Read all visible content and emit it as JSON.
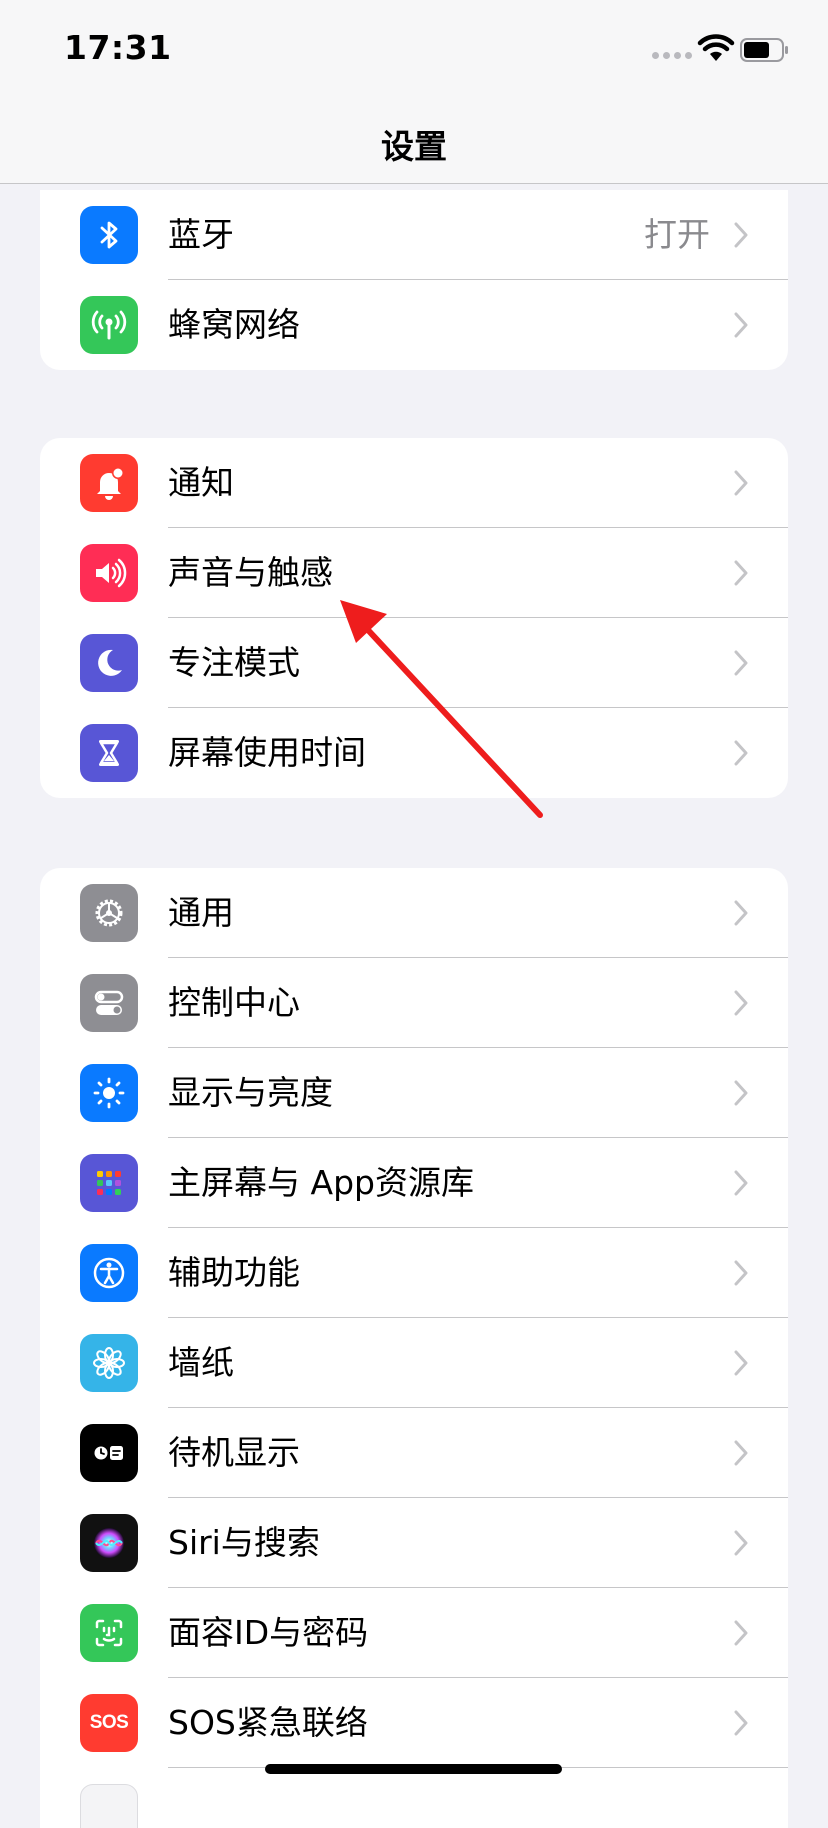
{
  "status_bar": {
    "time": "17:31"
  },
  "nav": {
    "title": "设置"
  },
  "group1": {
    "bluetooth": {
      "label": "蓝牙",
      "value": "打开"
    },
    "cellular": {
      "label": "蜂窝网络"
    }
  },
  "group2": {
    "notifications": {
      "label": "通知"
    },
    "sounds": {
      "label": "声音与触感"
    },
    "focus": {
      "label": "专注模式"
    },
    "screen_time": {
      "label": "屏幕使用时间"
    }
  },
  "group3": {
    "general": {
      "label": "通用"
    },
    "control_center": {
      "label": "控制中心"
    },
    "display": {
      "label": "显示与亮度"
    },
    "home_screen": {
      "label": "主屏幕与 App资源库"
    },
    "accessibility": {
      "label": "辅助功能"
    },
    "wallpaper": {
      "label": "墙纸"
    },
    "standby": {
      "label": "待机显示"
    },
    "siri": {
      "label": "Siri与搜索"
    },
    "face_id": {
      "label": "面容ID与密码"
    },
    "sos": {
      "label": "SOS紧急联络",
      "icon_text": "SOS"
    }
  },
  "colors": {
    "blue": "#0a7aff",
    "green": "#34c759",
    "red": "#ff3b30",
    "pink": "#ff2d55",
    "indigo": "#5856d6",
    "gray": "#8e8e93",
    "teal": "#35b4e8",
    "annotation_arrow": "#ee1d1d"
  }
}
